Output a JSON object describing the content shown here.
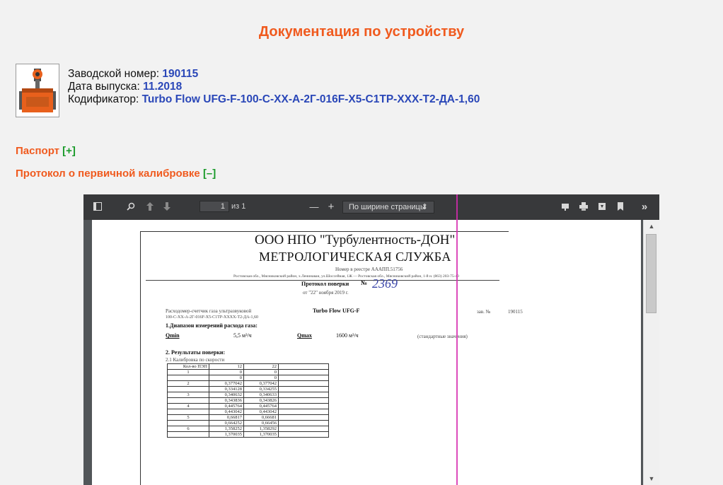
{
  "page_title": "Документация по устройству",
  "device": {
    "serial_label": "Заводской номер:",
    "serial_value": "190115",
    "date_label": "Дата выпуска:",
    "date_value": "11.2018",
    "code_label": "Кодификатор:",
    "code_value": "Turbo Flow UFG-F-100-C-XX-A-2Г-016F-X5-C1TP-XXX-T2-ДА-1,60"
  },
  "sections": {
    "passport_label": "Паспорт",
    "passport_toggle": "[+]",
    "protocol_label": "Протокол о первичной калибровке",
    "protocol_toggle": "[–]"
  },
  "viewer": {
    "page_number": "1",
    "page_of": "из 1",
    "zoom_minus": "—",
    "zoom_plus": "+",
    "zoom_value": "По ширине страницы",
    "zoom_caret": "⇕",
    "more": "»"
  },
  "document": {
    "org": "ООО НПО \"Турбулентность-ДОН\"",
    "service": "МЕТРОЛОГИЧЕСКАЯ СЛУЖБА",
    "reg_line": "Номер в реестре АААПП.51756",
    "address_line": "Ростовская обл., Мясниковский район, х.Ленинаван, ул.Шоссейная, 1Ж — Ростовская обл., Мясниковский район, 1-й н. (863) 203-75-40",
    "protocol_title": "Протокол поверки",
    "protocol_no_label": "№",
    "protocol_no": "2369",
    "protocol_date": "от \"22\" ноября 2019 г.",
    "meter_desc_1": "Расходомер-счетчик газа ультразвуковой",
    "meter_model": "Turbo Flow UFG-F",
    "meter_desc_2": "100-C-XX-A-2Г-016F-X5-C1TP-XXXX-T2-ДА-1,60",
    "serial_short_label": "зав. №",
    "serial_short": "190115",
    "range_title": "1.Диапазон измерений расхода газа:",
    "qmin_label": "Qmin",
    "qmin_value": "5,5 м³/ч",
    "qmax_label": "Qmax",
    "qmax_value": "1600 м³/ч",
    "note": "(стандартные значения)",
    "results_title": "2. Результаты поверки:",
    "results_sub": "2.1 Калибровка по скорости",
    "table_head": [
      "Кол-во ПЭП",
      "12",
      "22"
    ],
    "table_rows": [
      [
        "1",
        "0",
        "0"
      ],
      [
        "",
        "0",
        "0"
      ],
      [
        "2",
        "0,377042",
        "0,377042"
      ],
      [
        "",
        "0,334128",
        "0,334255"
      ],
      [
        "3",
        "0,340632",
        "0,340633"
      ],
      [
        "",
        "0,343836",
        "0,343826"
      ],
      [
        "4",
        "0,445764",
        "0,445764"
      ],
      [
        "",
        "0,443042",
        "0,443042"
      ],
      [
        "5",
        "0,66817",
        "0,66681"
      ],
      [
        "",
        "0,664252",
        "0,66456"
      ],
      [
        "6",
        "1,358252",
        "1,358292"
      ],
      [
        "",
        "1,370035",
        "1,370035"
      ]
    ]
  }
}
